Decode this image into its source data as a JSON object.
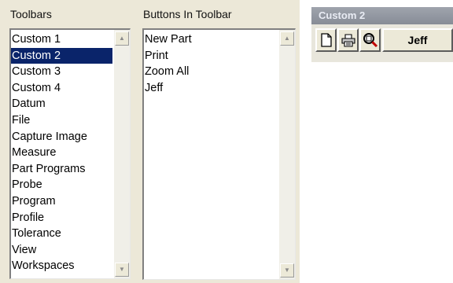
{
  "toolbars_group": {
    "label": "Toolbars",
    "items": [
      {
        "label": "Custom 1"
      },
      {
        "label": "Custom 2"
      },
      {
        "label": "Custom 3"
      },
      {
        "label": "Custom 4"
      },
      {
        "label": "Datum"
      },
      {
        "label": "File"
      },
      {
        "label": "Capture Image"
      },
      {
        "label": "Measure"
      },
      {
        "label": "Part Programs"
      },
      {
        "label": "Probe"
      },
      {
        "label": "Program"
      },
      {
        "label": "Profile"
      },
      {
        "label": "Tolerance"
      },
      {
        "label": "View"
      },
      {
        "label": "Workspaces"
      }
    ],
    "selected": "Custom 2"
  },
  "buttons_group": {
    "label": "Buttons In Toolbar",
    "items": [
      {
        "label": "New Part"
      },
      {
        "label": "Print"
      },
      {
        "label": "Zoom All"
      },
      {
        "label": "Jeff"
      }
    ]
  },
  "toolbar_preview": {
    "title": "Custom 2",
    "buttons": [
      {
        "icon": "new-document-icon"
      },
      {
        "icon": "print-icon"
      },
      {
        "icon": "zoom-all-icon"
      },
      {
        "label": "Jeff"
      }
    ]
  },
  "colors": {
    "panel_bg": "#ece8d8",
    "selection": "#0a246a",
    "titlebar": "#8f949e"
  }
}
